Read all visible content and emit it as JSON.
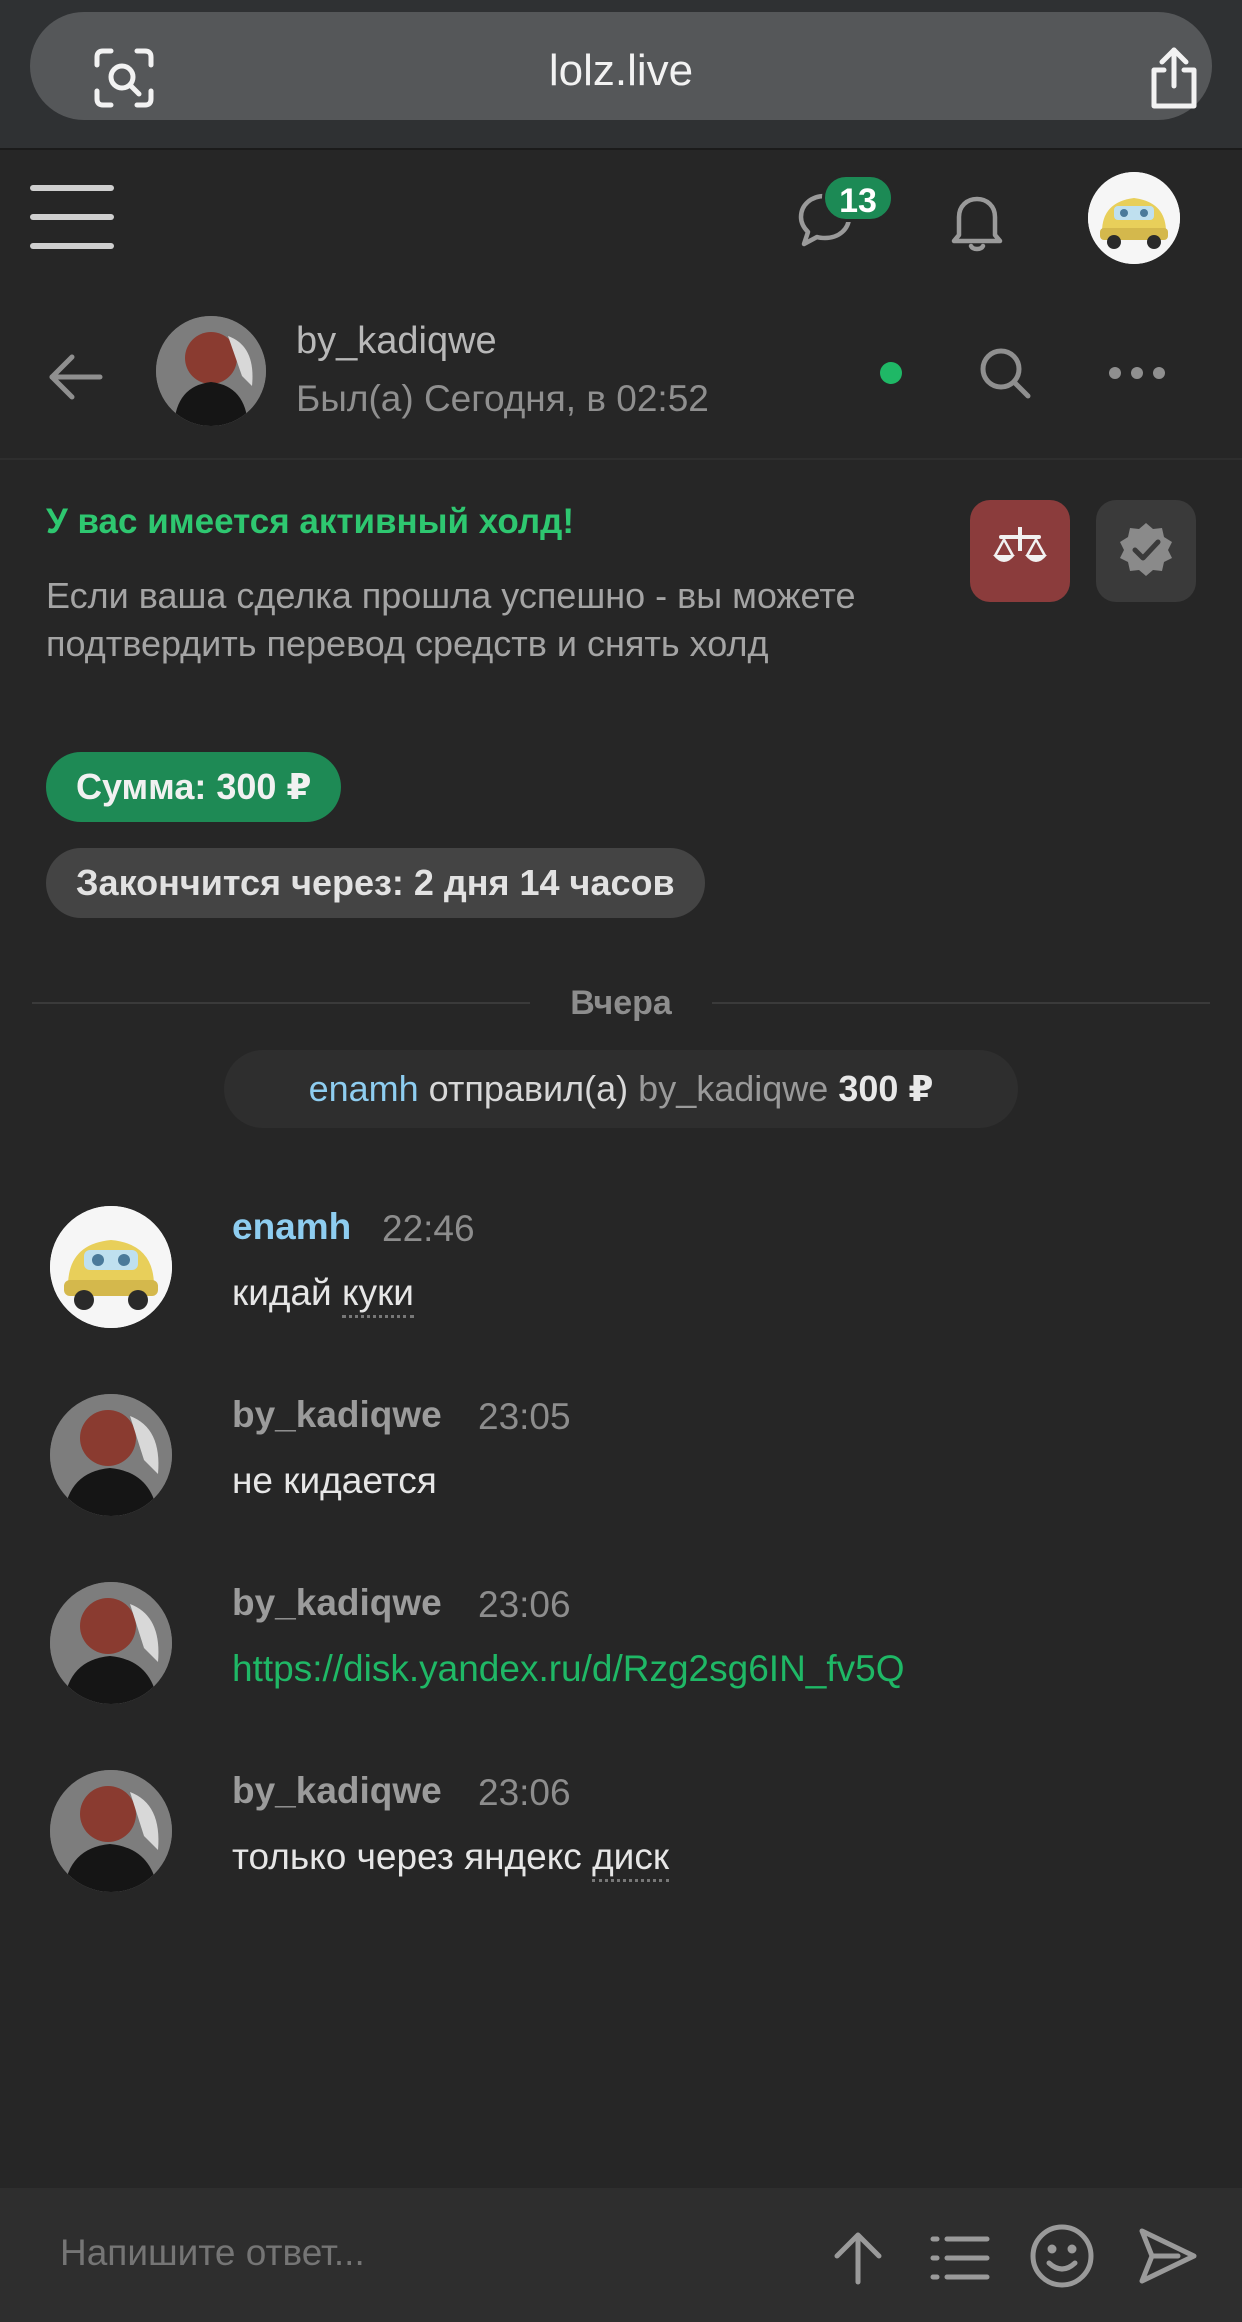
{
  "browser": {
    "url": "lolz.live"
  },
  "header": {
    "unread_messages": "13"
  },
  "conversation": {
    "name": "by_kadiqwe",
    "last_seen": "Был(а) Сегодня, в 02:52"
  },
  "hold": {
    "title": "У вас имеется активный холд!",
    "description": "Если ваша сделка прошла успешно - вы можете подтвердить перевод средств и снять холд",
    "sum_label": "Сумма: 300 ₽",
    "expires_label": "Закончится через: 2 дня 14 часов"
  },
  "date_divider": "Вчера",
  "transfer": {
    "sender": "enamh",
    "verb": "отправил(а)",
    "recipient": "by_kadiqwe",
    "amount": "300 ₽"
  },
  "messages": [
    {
      "author": "enamh",
      "time": "22:46",
      "text_a": "кидай ",
      "text_b": "куки",
      "text_c": ""
    },
    {
      "author": "by_kadiqwe",
      "time": "23:05",
      "text": "не кидается"
    },
    {
      "author": "by_kadiqwe",
      "time": "23:06",
      "link": "https://disk.yandex.ru/d/Rzg2sg6IN_fv5Q"
    },
    {
      "author": "by_kadiqwe",
      "time": "23:06",
      "text_a": "только через яндекс ",
      "text_b": "диск",
      "text_c": ""
    }
  ],
  "composer": {
    "placeholder": "Напишите ответ..."
  },
  "icons": {
    "lens": "lens-icon",
    "share": "share-icon",
    "menu": "hamburger-icon",
    "chat": "chat-bubble-icon",
    "bell": "bell-icon",
    "back": "arrow-left-icon",
    "search": "search-icon",
    "more": "more-dots-icon",
    "arbitration": "scales-icon",
    "confirm": "verified-badge-icon",
    "upload": "arrow-up-icon",
    "list": "list-icon",
    "emoji": "smiley-icon",
    "send": "send-icon"
  },
  "colors": {
    "accent_green": "#1fb866",
    "title_green": "#2ec770",
    "arbitration_red": "#8b3c3c",
    "username_blue": "#8ecdf0"
  }
}
